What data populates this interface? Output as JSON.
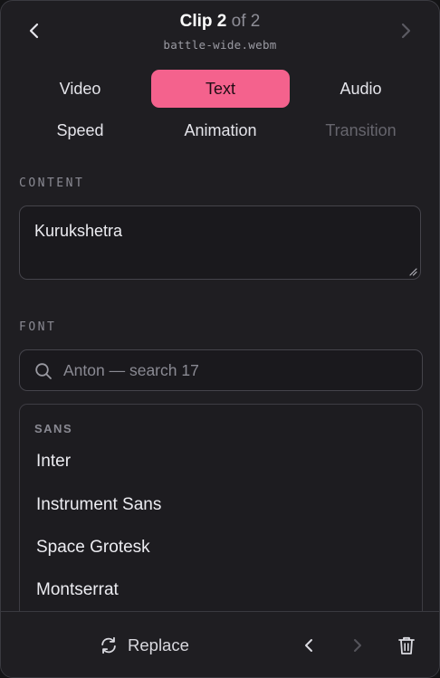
{
  "header": {
    "title_strong": "Clip 2",
    "title_muted": "of 2",
    "filename": "battle-wide.webm"
  },
  "tabs": [
    {
      "label": "Video",
      "state": "normal"
    },
    {
      "label": "Text",
      "state": "active"
    },
    {
      "label": "Audio",
      "state": "normal"
    },
    {
      "label": "Speed",
      "state": "normal"
    },
    {
      "label": "Animation",
      "state": "normal"
    },
    {
      "label": "Transition",
      "state": "disabled"
    }
  ],
  "content": {
    "label": "CONTENT",
    "value": "Kurukshetra"
  },
  "font": {
    "label": "FONT",
    "search_placeholder": "Anton — search 17",
    "group_label": "SANS",
    "items": [
      "Inter",
      "Instrument Sans",
      "Space Grotesk",
      "Montserrat"
    ]
  },
  "footer": {
    "replace_label": "Replace"
  },
  "colors": {
    "accent": "#f4628d",
    "panel_bg": "#1f1e22",
    "border": "#3a3a40"
  },
  "icons": {
    "prev": "chevron-left-icon",
    "next": "chevron-right-icon",
    "search": "search-icon",
    "replace": "refresh-icon",
    "delete": "trash-icon"
  }
}
